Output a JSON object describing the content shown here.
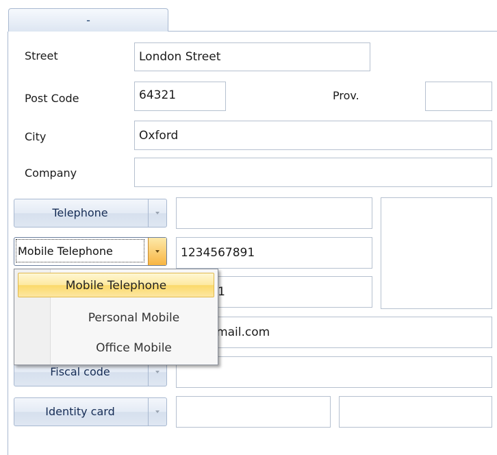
{
  "tab": {
    "label": "-"
  },
  "address": {
    "street_label": "Street",
    "street_value": "London Street",
    "postcode_label": "Post Code",
    "postcode_value": "64321",
    "prov_label": "Prov.",
    "prov_value": "",
    "city_label": "City",
    "city_value": "Oxford",
    "company_label": "Company",
    "company_value": ""
  },
  "contacts": {
    "telephone_label": "Telephone",
    "telephone_value": "",
    "mobile_label": "Mobile Telephone",
    "mobile_value": "1234567891",
    "third_value_visible": "567891",
    "email_value_visible": "own@mail.com",
    "fiscal_label": "Fiscal code",
    "fiscal_value": "",
    "identity_label": "Identity card",
    "identity_value_1": "",
    "identity_value_2": ""
  },
  "dropdown": {
    "items": [
      {
        "label": "Mobile Telephone",
        "selected": true
      },
      {
        "label": "Personal Mobile",
        "selected": false
      },
      {
        "label": "Office Mobile",
        "selected": false
      }
    ]
  },
  "colors": {
    "accent_selected": "#fbd96a",
    "border": "#b5c0cf"
  }
}
